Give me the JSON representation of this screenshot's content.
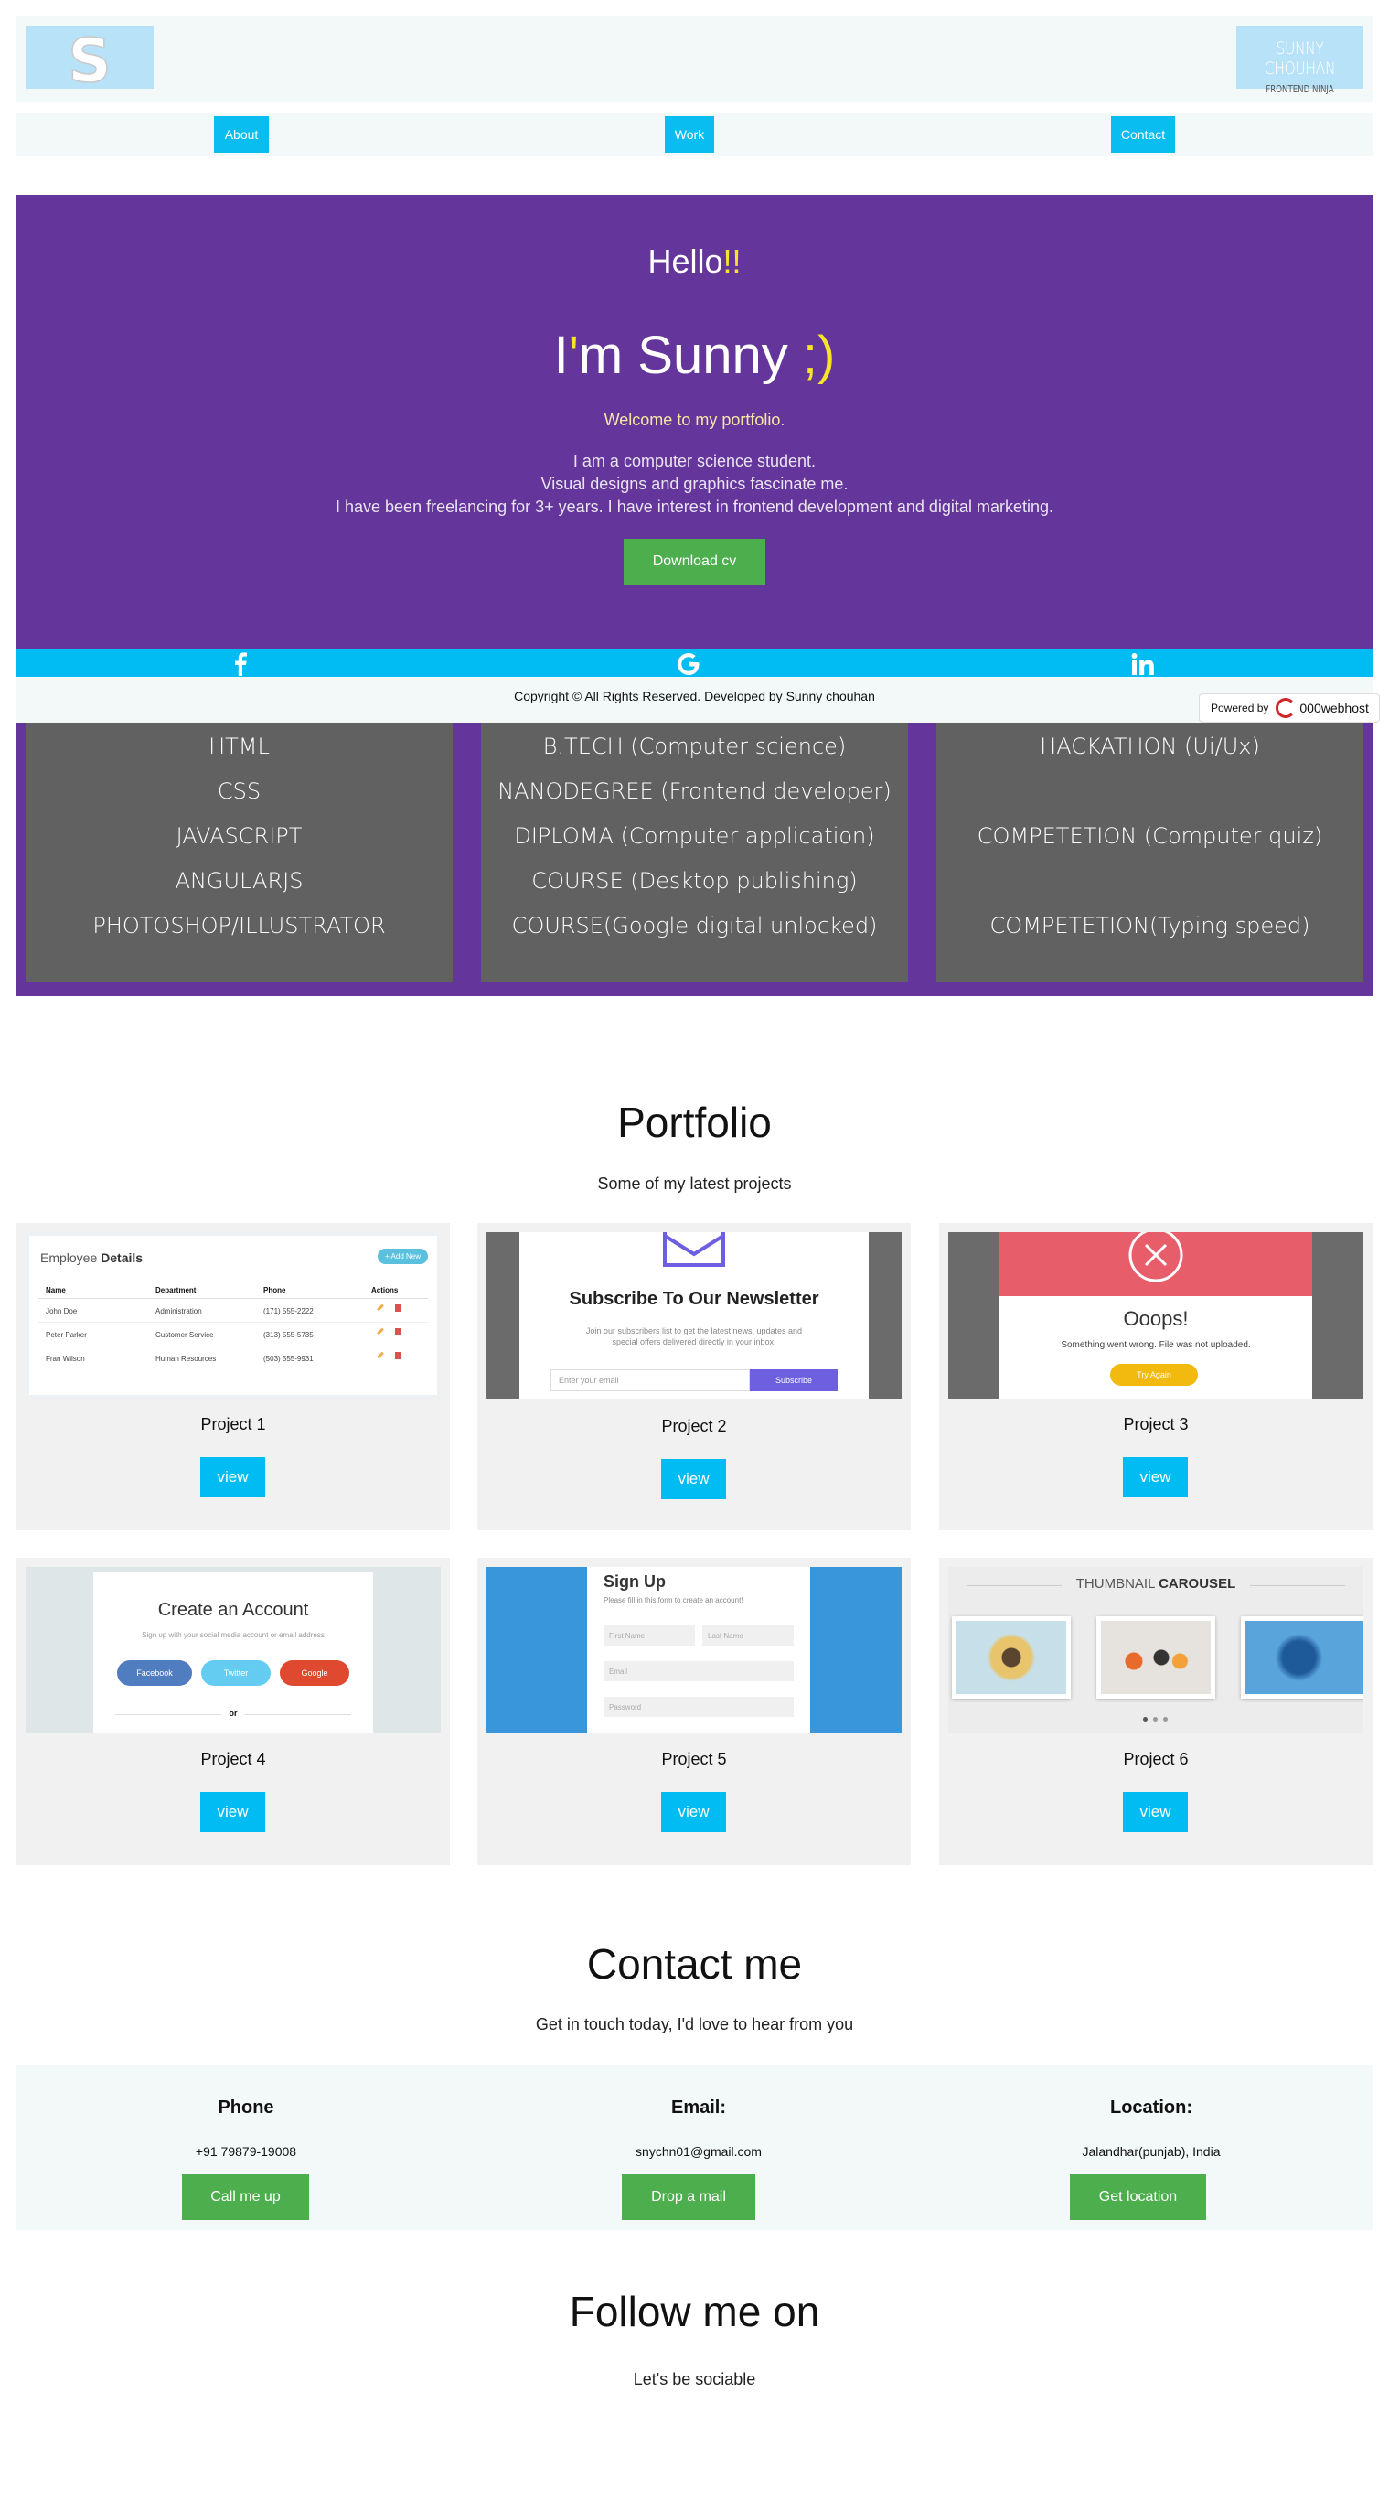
{
  "header": {
    "logo_letter": "S",
    "brand_name": "SUNNY CHOUHAN",
    "brand_tagline": "FRONTEND NINJA"
  },
  "nav": {
    "items": [
      "About",
      "Work",
      "Contact"
    ]
  },
  "hero": {
    "hello": "Hello",
    "hello_accent": "!!",
    "intro_a": "I",
    "intro_apostrophe": "'",
    "intro_b": "m Sunny",
    "intro_accent": ";)",
    "welcome": "Welcome to my portfolio.",
    "bio": [
      "I am a computer science student.",
      "Visual designs and graphics fascinate me.",
      "I have been freelancing for 3+ years. I have interest in frontend development and digital marketing."
    ],
    "download_label": "Download cv"
  },
  "social": {
    "icons": [
      "facebook-icon",
      "google-icon",
      "linkedin-icon"
    ]
  },
  "copyright": "Copyright © All Rights Reserved. Developed by Sunny chouhan",
  "powered_by": {
    "label": "Powered by",
    "brand": "000webhost"
  },
  "skills": {
    "col1": [
      "HTML",
      "CSS",
      "JAVASCRIPT",
      "ANGULARJS",
      "PHOTOSHOP/ILLUSTRATOR"
    ],
    "col2": [
      "B.TECH (Computer science)",
      "NANODEGREE (Frontend developer)",
      "DIPLOMA (Computer application)",
      "COURSE (Desktop publishing)",
      "COURSE(Google digital unlocked)"
    ],
    "col3": [
      "HACKATHON (Ui/Ux)",
      "COMPETETION (Computer quiz)",
      "COMPETETION(Typing speed)"
    ]
  },
  "portfolio": {
    "title": "Portfolio",
    "subtitle": "Some of my latest projects",
    "view_label": "view",
    "projects": [
      "Project 1",
      "Project 2",
      "Project 3",
      "Project 4",
      "Project 5",
      "Project 6"
    ],
    "thumb1": {
      "title_a": "Employee",
      "title_b": "Details",
      "add_label": "+ Add New",
      "headers": [
        "Name",
        "Department",
        "Phone",
        "Actions"
      ],
      "rows": [
        [
          "John Doe",
          "Administration",
          "(171) 555-2222"
        ],
        [
          "Peter Parker",
          "Customer Service",
          "(313) 555-5735"
        ],
        [
          "Fran Wilson",
          "Human Resources",
          "(503) 555-9931"
        ]
      ]
    },
    "thumb2": {
      "heading": "Subscribe To Our Newsletter",
      "text": "Join our subscribers list to get the latest news, updates and special offers delivered directly in your inbox.",
      "placeholder": "Enter your email",
      "button": "Subscribe"
    },
    "thumb3": {
      "heading": "Ooops!",
      "text": "Something went wrong. File was not uploaded.",
      "button": "Try Again"
    },
    "thumb4": {
      "heading": "Create an Account",
      "text": "Sign up with your social media account or email address",
      "buttons": [
        "Facebook",
        "Twitter",
        "Google"
      ],
      "or": "or"
    },
    "thumb5": {
      "heading": "Sign Up",
      "text": "Please fill in this form to create an account!",
      "fields": [
        "First Name",
        "Last Name",
        "Email",
        "Password"
      ]
    },
    "thumb6": {
      "heading_a": "THUMBNAIL",
      "heading_b": "CAROUSEL"
    }
  },
  "contact": {
    "title": "Contact me",
    "subtitle": "Get in touch today, I'd love to hear from you",
    "phone": {
      "label": "Phone",
      "value": "+91 79879-19008",
      "button": "Call me up"
    },
    "email": {
      "label": "Email:",
      "value": "snychn01@gmail.com",
      "button": "Drop a mail"
    },
    "location": {
      "label": "Location:",
      "value": "Jalandhar(punjab), India",
      "button": "Get location"
    }
  },
  "follow": {
    "title": "Follow me on",
    "subtitle": "Let's be sociable"
  },
  "colors": {
    "accent": "#00bcf2",
    "purple": "#64359a",
    "green": "#4cae4c",
    "yellow": "#f6e42b"
  }
}
